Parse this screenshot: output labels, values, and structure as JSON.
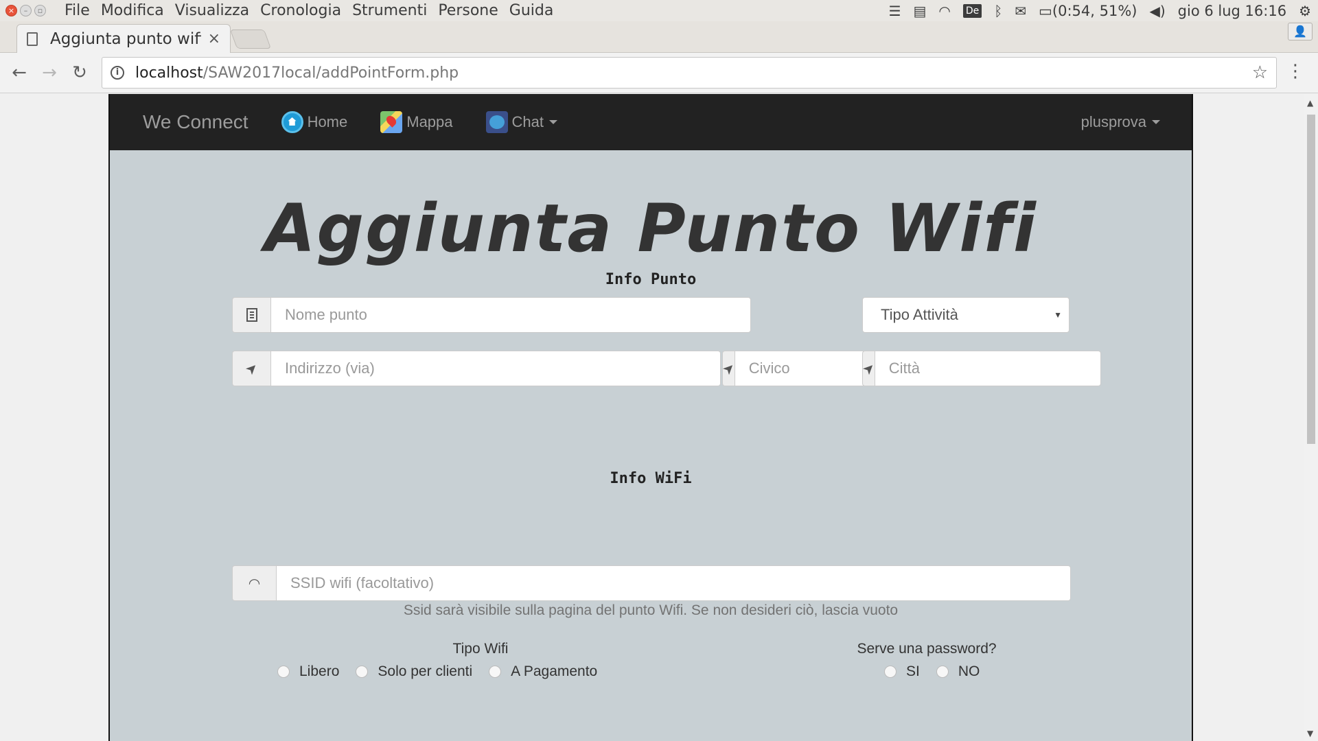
{
  "os": {
    "menu": [
      "File",
      "Modifica",
      "Visualizza",
      "Cronologia",
      "Strumenti",
      "Persone",
      "Guida"
    ],
    "battery": "(0:54, 51%)",
    "clock": "gio  6 lug 16:16",
    "tray_de": "De"
  },
  "browser": {
    "tab_title": "Aggiunta punto wifi",
    "tab_close": "×",
    "url_host": "localhost",
    "url_path": "/SAW2017local/addPointForm.php"
  },
  "navbar": {
    "brand": "We Connect",
    "home": "Home",
    "map": "Mappa",
    "chat": "Chat",
    "user": "plusprova"
  },
  "page": {
    "title": "Aggiunta Punto Wifi",
    "section_point": "Info Punto",
    "section_wifi": "Info WiFi",
    "name_placeholder": "Nome punto",
    "activity_select": "Tipo Attività",
    "address_placeholder": "Indirizzo (via)",
    "number_placeholder": "Civico",
    "city_placeholder": "Città",
    "ssid_placeholder": "SSID wifi (facoltativo)",
    "ssid_help": "Ssid sarà visibile sulla pagina del punto Wifi. Se non desideri ciò, lascia vuoto",
    "wifi_type_label": "Tipo Wifi",
    "wifi_types": [
      "Libero",
      "Solo per clienti",
      "A Pagamento"
    ],
    "password_label": "Serve una password?",
    "password_options": [
      "SI",
      "NO"
    ]
  }
}
